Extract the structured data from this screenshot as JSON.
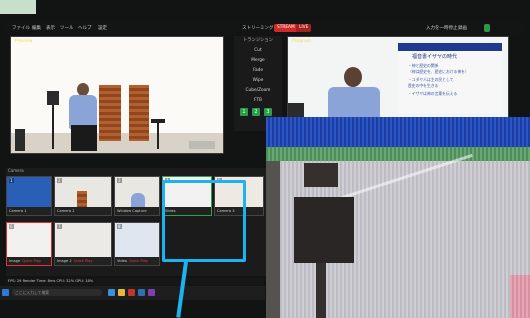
{
  "menubar": {
    "items": [
      "ファイル",
      "編集",
      "表示",
      "ツール",
      "ヘルプ",
      "設定"
    ],
    "right_status": "ストリーミング",
    "rec_label": "STREAM",
    "live_label": "LIVE",
    "right_menu": [
      "入力を一時停止",
      "録画"
    ]
  },
  "preview": {
    "label": "Preview"
  },
  "program": {
    "label": "Program",
    "slide_title": "福音書イザヤの時代",
    "slide_lines": [
      "・神と歴史の関係",
      "  （神は歴史を、歴史における神を）",
      "・ユダヤ人は主の民として",
      "  歴史の中を生きる",
      "・イザヤは神の言葉を伝える"
    ]
  },
  "controls": {
    "header": "トランジション",
    "items": [
      "Cut",
      "Merge",
      "Fade",
      "Wipe",
      "Cube/Zoom",
      "FTB"
    ],
    "buttons": [
      "1",
      "2",
      "3"
    ]
  },
  "bins": {
    "row1_label": "Camera",
    "items": [
      {
        "num": "1",
        "title": "Camera 1",
        "meta": "Close",
        "live": false
      },
      {
        "num": "2",
        "title": "Camera 2",
        "meta": "Quick Play",
        "live": false
      },
      {
        "num": "3",
        "title": "Window Capture",
        "meta": "Quick Play",
        "live": true
      },
      {
        "num": "4",
        "title": "Slides",
        "meta": "Quick Play",
        "live": false
      },
      {
        "num": "5",
        "title": "Camera 3",
        "meta": "Quick Play",
        "live": false
      },
      {
        "num": "6",
        "title": "Image",
        "meta": "Quick Play",
        "live": false
      },
      {
        "num": "7",
        "title": "Image 2",
        "meta": "Quick Play",
        "live": false
      },
      {
        "num": "8",
        "title": "Video",
        "meta": "Quick Play",
        "live": false
      }
    ]
  },
  "status": {
    "text": "FPS: 29  Render Time: 8ms  CPU: 32%  GPU: 18%"
  },
  "taskbar": {
    "search": "ここに入力して検索"
  }
}
